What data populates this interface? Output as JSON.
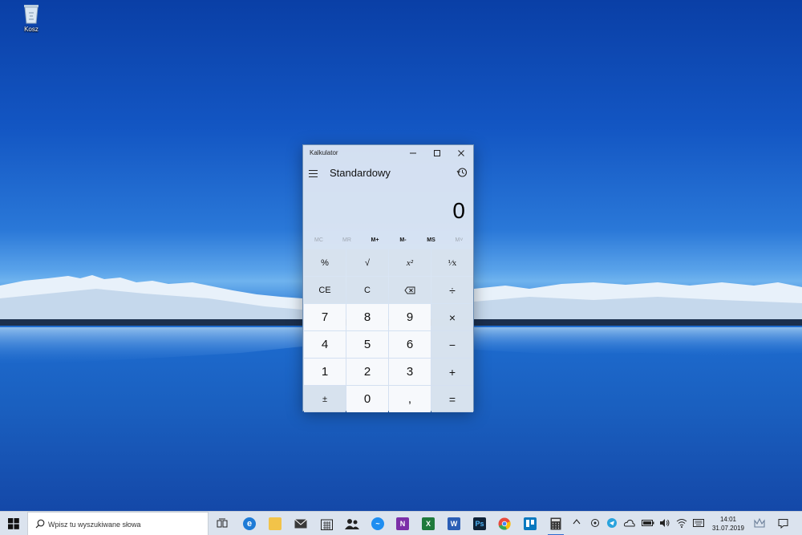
{
  "desktop": {
    "icons": [
      {
        "label": "Kosz",
        "icon": "recycle-bin-icon"
      }
    ]
  },
  "calculator": {
    "title": "Kalkulator",
    "mode": "Standardowy",
    "display": "0",
    "memory": [
      "MC",
      "MR",
      "M+",
      "M-",
      "MS",
      "M˅"
    ],
    "keys": [
      [
        "%",
        "√",
        "x²",
        "¹⁄x"
      ],
      [
        "CE",
        "C",
        "⌫",
        "÷"
      ],
      [
        "7",
        "8",
        "9",
        "×"
      ],
      [
        "4",
        "5",
        "6",
        "−"
      ],
      [
        "1",
        "2",
        "3",
        "+"
      ],
      [
        "±",
        "0",
        ",",
        "="
      ]
    ]
  },
  "taskbar": {
    "search_placeholder": "Wpisz tu wyszukiwane słowa",
    "apps": [
      "task-view-icon",
      "edge-icon",
      "file-explorer-icon",
      "mail-icon",
      "calendar-icon",
      "people-icon",
      "messenger-icon",
      "onenote-icon",
      "excel-icon",
      "word-icon",
      "photoshop-icon",
      "chrome-icon",
      "trello-icon",
      "calculator-icon"
    ],
    "clock": {
      "time": "14:01",
      "date": "31.07.2019"
    }
  },
  "colors": {
    "accent": "#2e6ccf",
    "taskbar": "#dbe3ee",
    "calc_bg": "#e2eaf4"
  }
}
